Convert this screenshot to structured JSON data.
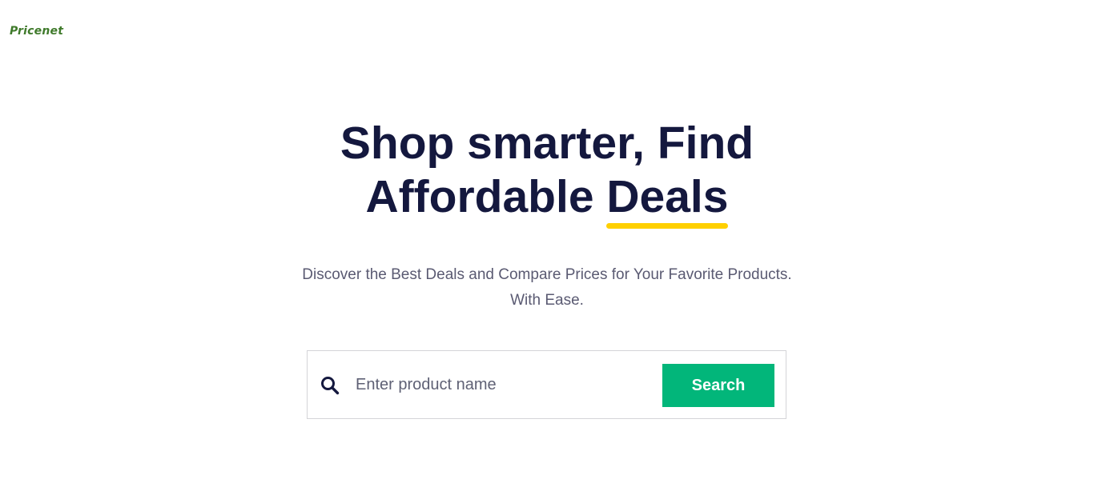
{
  "brand": {
    "logo_text": "Pricenet",
    "logo_color": "#3f7a2b"
  },
  "hero": {
    "title_line1": "Shop smarter, Find",
    "title_line2_prefix": "Affordable",
    "title_highlight": "Deals",
    "title_color": "#14183e",
    "highlight_color": "#ffd000"
  },
  "subtitle": {
    "line1": "Discover the Best Deals and Compare Prices for Your Favorite Products.",
    "line2": "With Ease."
  },
  "search": {
    "icon": "search-icon",
    "placeholder": "Enter product name",
    "value": "",
    "button_label": "Search",
    "button_color": "#02b67a"
  }
}
